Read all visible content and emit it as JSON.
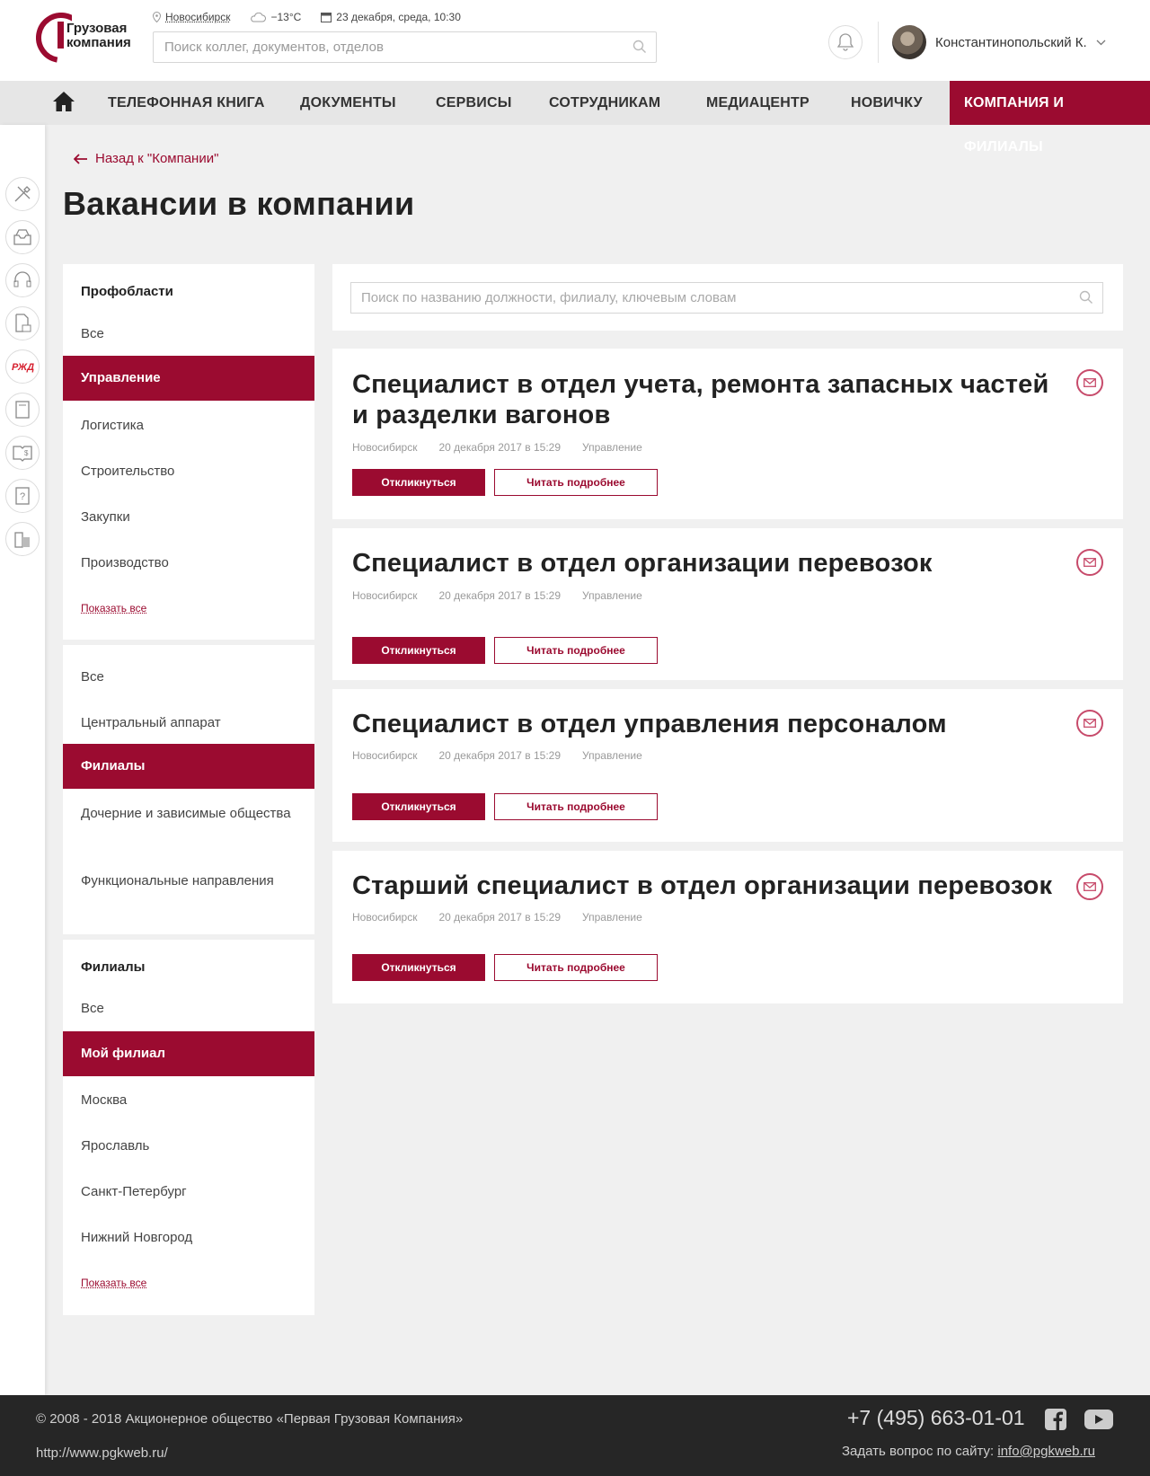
{
  "header": {
    "logo_line1": "Грузовая",
    "logo_line2": "компания",
    "city": "Новосибирск",
    "temperature": "−13°C",
    "datetime": "23 декабря, среда, 10:30",
    "search_placeholder": "Поиск коллег, документов, отделов",
    "user_name": "Константинопольский К."
  },
  "nav": {
    "items": [
      {
        "label": "ТЕЛЕФОННАЯ КНИГА"
      },
      {
        "label": "ДОКУМЕНТЫ"
      },
      {
        "label": "СЕРВИСЫ"
      },
      {
        "label": "СОТРУДНИКАМ"
      },
      {
        "label": "МЕДИАЦЕНТР"
      },
      {
        "label": "НОВИЧКУ"
      },
      {
        "label": "КОМПАНИЯ И ФИЛИАЛЫ",
        "active": true
      }
    ]
  },
  "rail": {
    "icons": [
      "tools-icon",
      "inbox-icon",
      "headset-icon",
      "document-mail-icon",
      "rzd-logo-icon",
      "book-icon",
      "finance-book-icon",
      "help-icon",
      "building-icon"
    ]
  },
  "page": {
    "back_label": "Назад к \"Компании\"",
    "title": "Вакансии в компании"
  },
  "filters": {
    "prof": {
      "heading": "Профобласти",
      "items": [
        "Все",
        "Управление",
        "Логистика",
        "Строительство",
        "Закупки",
        "Производство"
      ],
      "active": "Управление",
      "more": "Показать все"
    },
    "org": {
      "items": [
        "Все",
        "Центральный аппарат",
        "Филиалы",
        "Дочерние и зависимые общества",
        "Функциональные направления"
      ],
      "active": "Филиалы"
    },
    "branches": {
      "heading": "Филиалы",
      "items": [
        "Все",
        "Мой филиал",
        "Москва",
        "Ярославль",
        "Санкт-Петербург",
        "Нижний Новгород"
      ],
      "active": "Мой филиал",
      "more": "Показать все"
    }
  },
  "vacancy_search": {
    "placeholder": "Поиск по названию должности, филиалу, ключевым словам"
  },
  "vacancies": [
    {
      "title": "Специалист в отдел учета, ремонта запасных частей и разделки вагонов",
      "city": "Новосибирск",
      "date": "20 декабря 2017 в 15:29",
      "area": "Управление",
      "apply": "Откликнуться",
      "details": "Читать подробнее"
    },
    {
      "title": "Специалист в отдел организации перевозок",
      "city": "Новосибирск",
      "date": "20 декабря 2017 в 15:29",
      "area": "Управление",
      "apply": "Откликнуться",
      "details": "Читать подробнее"
    },
    {
      "title": "Специалист в отдел управления персоналом",
      "city": "Новосибирск",
      "date": "20 декабря 2017 в 15:29",
      "area": "Управление",
      "apply": "Откликнуться",
      "details": "Читать подробнее"
    },
    {
      "title": "Старший специалист в отдел организации перевозок",
      "city": "Новосибирск",
      "date": "20 декабря 2017 в 15:29",
      "area": "Управление",
      "apply": "Откликнуться",
      "details": "Читать подробнее"
    }
  ],
  "footer": {
    "copyright": "© 2008 - 2018 Акционерное общество «Первая Грузовая Компания»",
    "site": "http://www.pgkweb.ru/",
    "phone": "+7 (495) 663-01-01",
    "ask_label": "Задать вопрос по сайту:",
    "ask_email": "info@pgkweb.ru"
  },
  "colors": {
    "accent": "#9b0b30",
    "nav_bg": "#e6e6e6",
    "page_bg": "#f0f0f0",
    "footer_bg": "#262626"
  }
}
